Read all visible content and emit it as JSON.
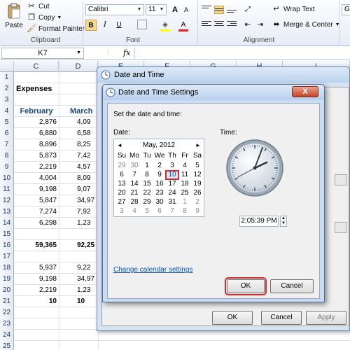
{
  "ribbon": {
    "clipboard": {
      "paste": "Paste",
      "cut": "Cut",
      "copy": "Copy",
      "format_painter": "Format Painter",
      "group": "Clipboard"
    },
    "font": {
      "name": "Calibri",
      "size": "11",
      "bold": "B",
      "italic": "I",
      "underline": "U",
      "grow": "A",
      "shrink": "A",
      "group": "Font"
    },
    "alignment": {
      "wrap_text": "Wrap Text",
      "merge_center": "Merge & Center",
      "group": "Alignment"
    },
    "number": {
      "format": "Ge"
    }
  },
  "formula_bar": {
    "name_box": "K7",
    "fx": "fx",
    "value": ""
  },
  "grid": {
    "columns": [
      "C",
      "D",
      "E",
      "F",
      "G",
      "H",
      "I"
    ],
    "rows": [
      {
        "n": "1",
        "c": "",
        "d": ""
      },
      {
        "n": "2",
        "c": "Expenses",
        "d": ""
      },
      {
        "n": "3",
        "c": "",
        "d": ""
      },
      {
        "n": "4",
        "c": "February",
        "d": "March"
      },
      {
        "n": "5",
        "c": "2,876",
        "d": "4,09"
      },
      {
        "n": "6",
        "c": "6,880",
        "d": "6,58"
      },
      {
        "n": "7",
        "c": "8,896",
        "d": "8,25"
      },
      {
        "n": "8",
        "c": "5,873",
        "d": "7,42"
      },
      {
        "n": "9",
        "c": "2,219",
        "d": "4,57"
      },
      {
        "n": "10",
        "c": "4,004",
        "d": "8,09"
      },
      {
        "n": "11",
        "c": "9,198",
        "d": "9,07"
      },
      {
        "n": "12",
        "c": "5,847",
        "d": "34,97"
      },
      {
        "n": "13",
        "c": "7,274",
        "d": "7,92"
      },
      {
        "n": "14",
        "c": "6,298",
        "d": "1,23"
      },
      {
        "n": "15",
        "c": "",
        "d": ""
      },
      {
        "n": "16",
        "c": "59,365",
        "d": "92,25"
      },
      {
        "n": "17",
        "c": "",
        "d": ""
      },
      {
        "n": "18",
        "c": "5,937",
        "d": "9,22"
      },
      {
        "n": "19",
        "c": "9,198",
        "d": "34,97"
      },
      {
        "n": "20",
        "c": "2,219",
        "d": "1,23"
      },
      {
        "n": "21",
        "c": "10",
        "d": "10"
      },
      {
        "n": "22",
        "c": "",
        "d": ""
      },
      {
        "n": "23",
        "c": "",
        "d": ""
      },
      {
        "n": "24",
        "c": "",
        "d": ""
      },
      {
        "n": "25",
        "c": "",
        "d": ""
      }
    ]
  },
  "outer_dialog": {
    "title": "Date and Time",
    "ok": "OK",
    "cancel": "Cancel",
    "apply": "Apply"
  },
  "inner_dialog": {
    "title": "Date and Time Settings",
    "close": "X",
    "instruction": "Set the date and time:",
    "date_label": "Date:",
    "time_label": "Time:",
    "calendar": {
      "month": "May, 2012",
      "prev": "◄",
      "next": "►",
      "weekdays": [
        "Su",
        "Mo",
        "Tu",
        "We",
        "Th",
        "Fr",
        "Sa"
      ],
      "weeks": [
        [
          "29",
          "30",
          "1",
          "2",
          "3",
          "4",
          "5"
        ],
        [
          "6",
          "7",
          "8",
          "9",
          "10",
          "11",
          "12"
        ],
        [
          "13",
          "14",
          "15",
          "16",
          "17",
          "18",
          "19"
        ],
        [
          "20",
          "21",
          "22",
          "23",
          "24",
          "25",
          "26"
        ],
        [
          "27",
          "28",
          "29",
          "30",
          "31",
          "1",
          "2"
        ],
        [
          "3",
          "4",
          "5",
          "6",
          "7",
          "8",
          "9"
        ]
      ],
      "selected": "10"
    },
    "time_value": "2:05:39 PM",
    "change_link": "Change calendar settings",
    "ok": "OK",
    "cancel": "Cancel"
  },
  "colors": {
    "accent": "#1f497d",
    "highlight": "#d12b2b",
    "link": "#0a53b8"
  }
}
